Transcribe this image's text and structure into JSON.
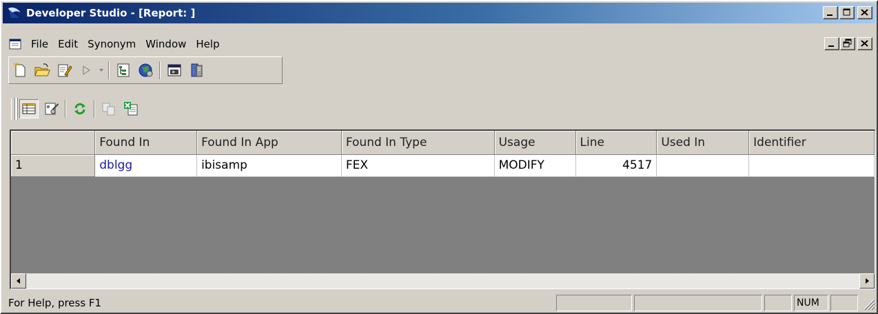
{
  "window": {
    "title": "Developer Studio - [Report: ]"
  },
  "menubar": {
    "items": [
      "File",
      "Edit",
      "Synonym",
      "Window",
      "Help"
    ]
  },
  "toolbar1": {
    "buttons": [
      "new-document-icon",
      "open-folder-icon",
      "edit-document-icon",
      "run-icon",
      "run-dropdown-arrow",
      "tree-view-icon",
      "globe-icon",
      "console-window-icon",
      "server-icon"
    ]
  },
  "toolbar2": {
    "buttons": [
      "grid-view-icon",
      "properties-icon",
      "refresh-icon",
      "copy-disabled-icon",
      "export-excel-icon"
    ]
  },
  "grid": {
    "columns": [
      "",
      "Found In",
      "Found In App",
      "Found In Type",
      "Usage",
      "Line",
      "Used In",
      "Identifier"
    ],
    "rows": [
      {
        "num": "1",
        "found_in": "dblgg",
        "found_in_app": "ibisamp",
        "found_in_type": "FEX",
        "usage": "MODIFY",
        "line": "4517",
        "used_in": "",
        "identifier": ""
      }
    ]
  },
  "statusbar": {
    "help_text": "For Help, press F1",
    "num_indicator": "NUM"
  },
  "colors": {
    "titlebar_start": "#0a246a",
    "titlebar_end": "#a6caf0",
    "link": "#1a1aa6",
    "grid_background": "#808080",
    "chrome": "#d4d0c8"
  }
}
